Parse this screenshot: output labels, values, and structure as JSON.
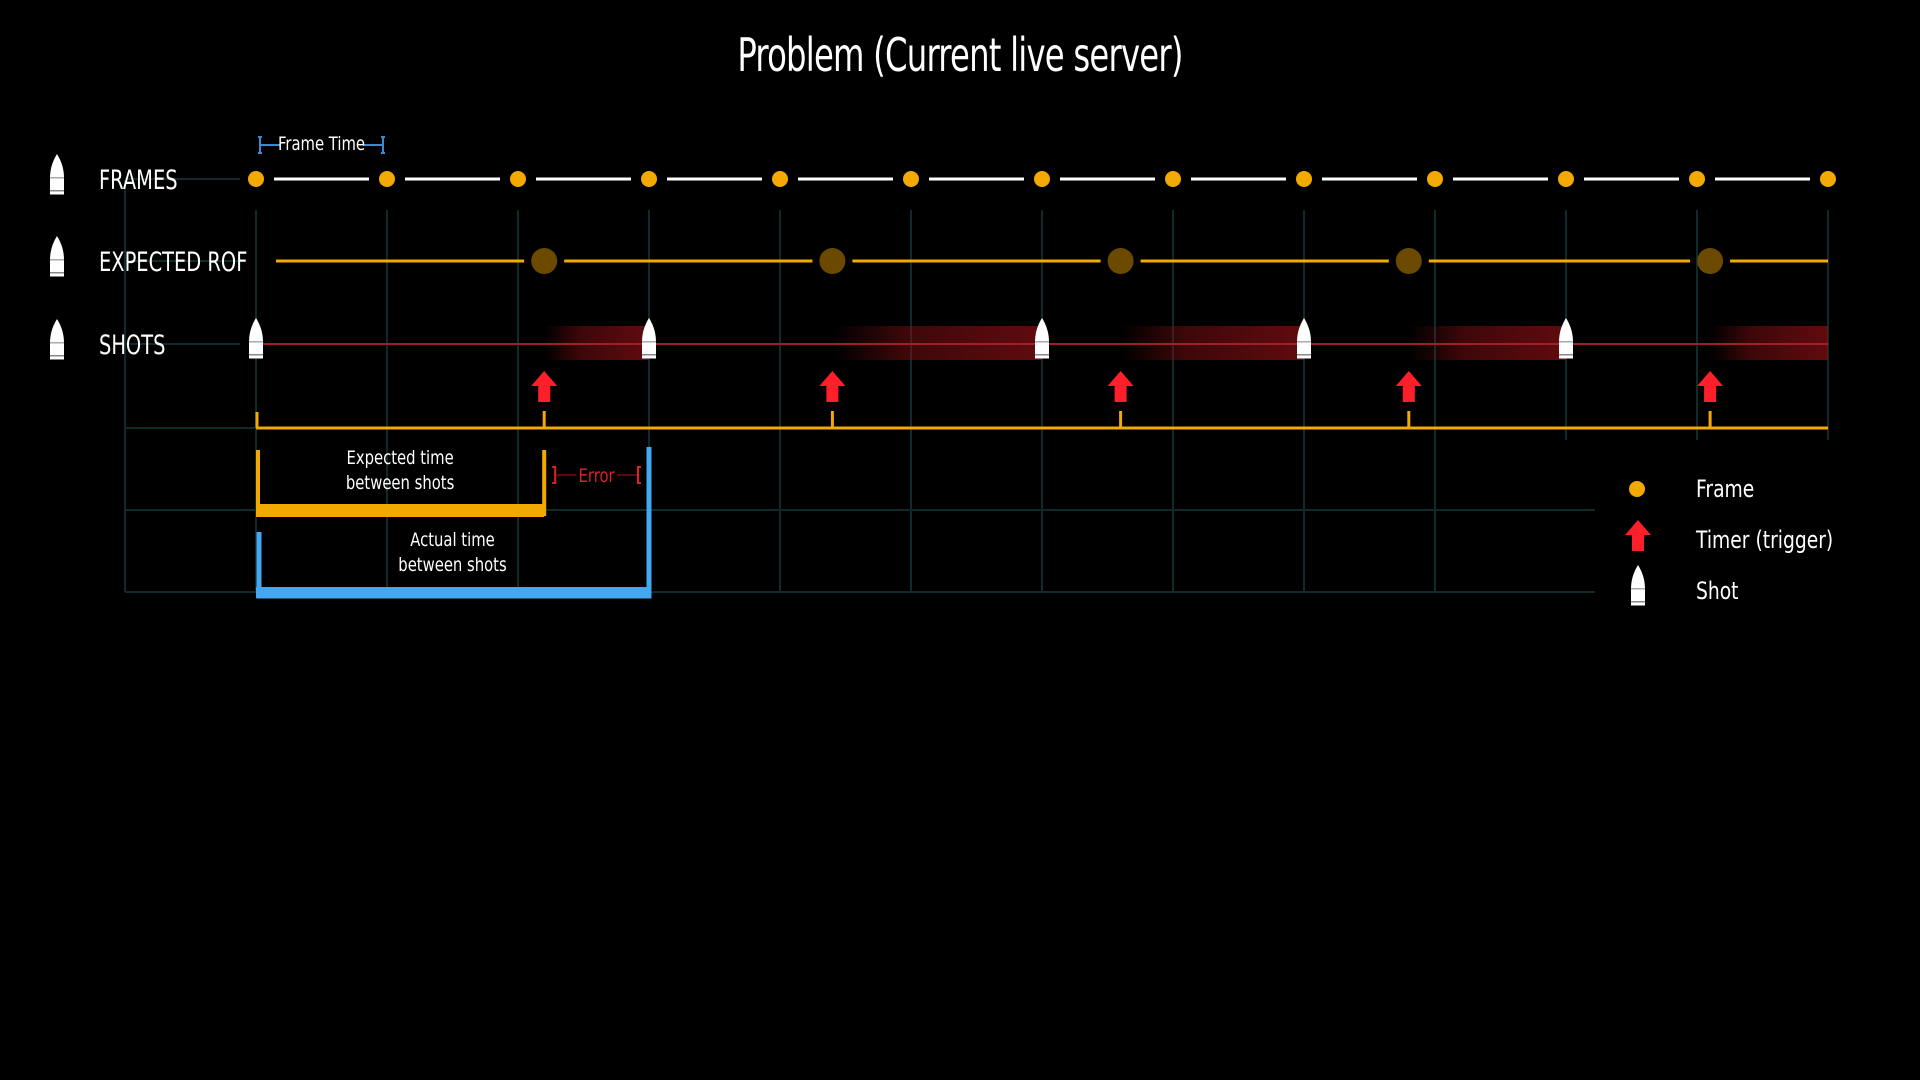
{
  "title": "Problem (Current live server)",
  "rows": [
    {
      "id": "frames",
      "label": "FRAMES"
    },
    {
      "id": "expected_rof",
      "label": "EXPECTED ROF"
    },
    {
      "id": "shots",
      "label": "SHOTS"
    }
  ],
  "annotations": {
    "frame_time": "Frame Time",
    "expected_time": [
      "Expected time",
      "between shots"
    ],
    "actual_time": [
      "Actual time",
      "between shots"
    ],
    "error": "Error"
  },
  "legend": [
    {
      "icon": "frame-dot-icon",
      "label": "Frame"
    },
    {
      "icon": "timer-arrow-icon",
      "label": "Timer (trigger)"
    },
    {
      "icon": "bullet-icon",
      "label": "Shot"
    }
  ],
  "colors": {
    "frame": "#f2a900",
    "rof_dot": "#6b4a00",
    "trigger": "#ff1f2a",
    "shot_trail": "#8a1015",
    "expected": "#f2a900",
    "actual": "#44a8f0",
    "error": "#e0202a",
    "grid": "#0f2a2a",
    "frame_time_bracket": "#3a8ad0"
  },
  "chart_data": {
    "type": "timeline",
    "time_unit": "frames",
    "frames": [
      0,
      1,
      2,
      3,
      4,
      5,
      6,
      7,
      8,
      9,
      10,
      11,
      12
    ],
    "expected_rof_times": [
      2.2,
      4.4,
      6.6,
      8.8,
      11.1
    ],
    "timer_triggers": [
      2.2,
      4.4,
      6.6,
      8.8,
      11.1
    ],
    "shots": [
      0,
      3,
      6,
      8,
      10
    ],
    "shot_delay_trails": [
      {
        "from": 2.2,
        "to": 3
      },
      {
        "from": 4.4,
        "to": 6
      },
      {
        "from": 6.6,
        "to": 8
      },
      {
        "from": 8.8,
        "to": 10
      },
      {
        "from": 11.1,
        "to": 12
      }
    ],
    "expected_interval": {
      "from": 0,
      "to": 2.2
    },
    "actual_interval": {
      "from": 0,
      "to": 3
    },
    "error_interval": {
      "from": 2.2,
      "to": 3
    }
  }
}
